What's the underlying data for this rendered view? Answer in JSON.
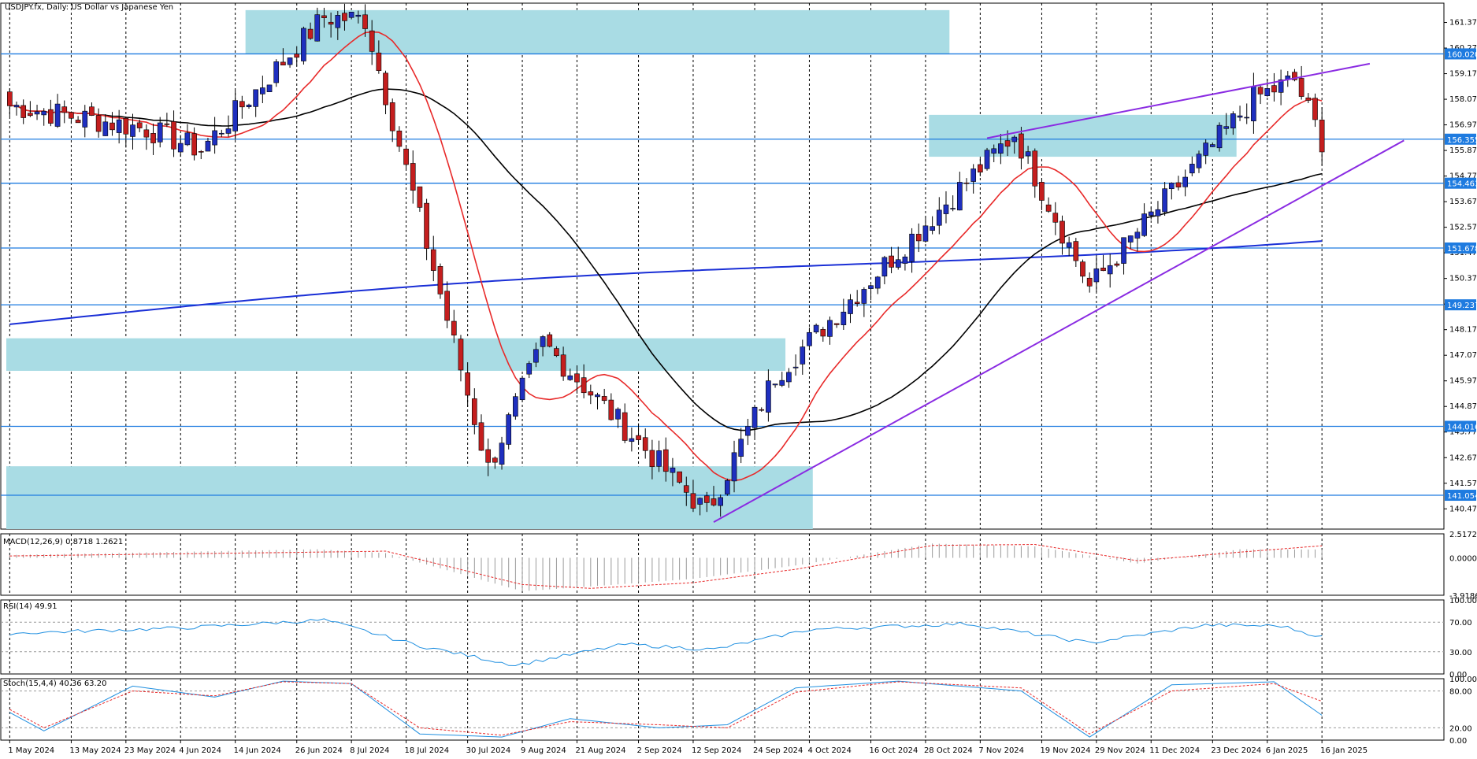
{
  "header": {
    "symbol_title": "USDJPY.fx, Daily:  US Dollar vs Japanese Yen"
  },
  "colors": {
    "bull": "#1f2fbf",
    "bear": "#c41e1e",
    "zone": "#a9dce4",
    "hline": "#1e7be0",
    "ema_fast": "#e82a2a",
    "sma_mid": "#000000",
    "sma_slow": "#1a2fd6",
    "trend": "#8a2be2",
    "osc": "#1f8fe0",
    "signal": "#e82a2a",
    "label_bg": "#1e7be0",
    "grid": "#000000"
  },
  "chart_data": [
    {
      "type": "candlestick",
      "name": "price",
      "title": "USDJPY.fx, Daily:  US Dollar vs Japanese Yen",
      "ylim": [
        139.6,
        162.2
      ],
      "grid": true,
      "y_ticks": [
        "161.370",
        "160.270",
        "159.170",
        "158.070",
        "156.970",
        "155.870",
        "154.770",
        "153.670",
        "152.570",
        "151.470",
        "150.370",
        "149.270",
        "148.170",
        "147.070",
        "145.970",
        "144.870",
        "143.770",
        "142.670",
        "141.570",
        "140.470"
      ],
      "level_labels": [
        {
          "value": 160.02,
          "label": "160.020"
        },
        {
          "value": 156.355,
          "label": "156.355"
        },
        {
          "value": 154.463,
          "label": "154.463"
        },
        {
          "value": 151.678,
          "label": "151.678"
        },
        {
          "value": 149.237,
          "label": "149.237"
        },
        {
          "value": 144.016,
          "label": "144.016"
        },
        {
          "value": 141.054,
          "label": "141.054"
        }
      ],
      "current_price_label": "156.355",
      "x_labels": [
        {
          "index": 0,
          "label": "1 May 2024"
        },
        {
          "index": 9,
          "label": "13 May 2024"
        },
        {
          "index": 17,
          "label": "23 May 2024"
        },
        {
          "index": 25,
          "label": "4 Jun 2024"
        },
        {
          "index": 33,
          "label": "14 Jun 2024"
        },
        {
          "index": 42,
          "label": "26 Jun 2024"
        },
        {
          "index": 50,
          "label": "8 Jul 2024"
        },
        {
          "index": 58,
          "label": "18 Jul 2024"
        },
        {
          "index": 67,
          "label": "30 Jul 2024"
        },
        {
          "index": 75,
          "label": "9 Aug 2024"
        },
        {
          "index": 83,
          "label": "21 Aug 2024"
        },
        {
          "index": 92,
          "label": "2 Sep 2024"
        },
        {
          "index": 100,
          "label": "12 Sep 2024"
        },
        {
          "index": 109,
          "label": "24 Sep 2024"
        },
        {
          "index": 117,
          "label": "4 Oct 2024"
        },
        {
          "index": 126,
          "label": "16 Oct 2024"
        },
        {
          "index": 134,
          "label": "28 Oct 2024"
        },
        {
          "index": 142,
          "label": "7 Nov 2024"
        },
        {
          "index": 151,
          "label": "19 Nov 2024"
        },
        {
          "index": 159,
          "label": "29 Nov 2024"
        },
        {
          "index": 167,
          "label": "11 Dec 2024"
        },
        {
          "index": 176,
          "label": "23 Dec 2024"
        },
        {
          "index": 184,
          "label": "6 Jan 2025"
        },
        {
          "index": 192,
          "label": "16 Jan 2025"
        }
      ],
      "zones": [
        {
          "i0": 35,
          "i1": 138,
          "top": 161.9,
          "bottom": 160.0
        },
        {
          "i0": 0,
          "i1": 114,
          "top": 147.8,
          "bottom": 146.4
        },
        {
          "i0": 0,
          "i1": 118,
          "top": 142.3,
          "bottom": 139.6
        },
        {
          "i0": 135,
          "i1": 180,
          "top": 157.4,
          "bottom": 155.6
        }
      ],
      "trend_lines": [
        {
          "i0": 103,
          "v0": 139.9,
          "i1": 204,
          "v1": 156.3
        },
        {
          "i0": 143,
          "v0": 156.4,
          "i1": 199,
          "v1": 159.6
        }
      ],
      "key_points": [
        {
          "index": 0,
          "price": 157.8
        },
        {
          "index": 20,
          "price": 156.8
        },
        {
          "index": 28,
          "price": 155.9
        },
        {
          "index": 46,
          "price": 161.6
        },
        {
          "index": 52,
          "price": 161.5
        },
        {
          "index": 70,
          "price": 142.2
        },
        {
          "index": 78,
          "price": 147.6
        },
        {
          "index": 102,
          "price": 140.3
        },
        {
          "index": 112,
          "price": 146.2
        },
        {
          "index": 147,
          "price": 156.6
        },
        {
          "index": 158,
          "price": 150.0
        },
        {
          "index": 182,
          "price": 158.1
        },
        {
          "index": 188,
          "price": 158.9
        },
        {
          "index": 192,
          "price": 156.3
        }
      ]
    },
    {
      "type": "line",
      "name": "macd",
      "title": "MACD(12,26,9) 0.8718 1.2621",
      "ylim": [
        -3.9186,
        2.5172
      ],
      "y_ticks": [
        "2.5172",
        "0.0000",
        "-3.9186"
      ],
      "key_points": [
        {
          "index": 0,
          "main": 0.3,
          "signal": 0.2
        },
        {
          "index": 45,
          "main": 0.9,
          "signal": 0.6
        },
        {
          "index": 55,
          "main": 0.5,
          "signal": 0.7
        },
        {
          "index": 75,
          "main": -3.5,
          "signal": -2.8
        },
        {
          "index": 85,
          "main": -3.0,
          "signal": -3.2
        },
        {
          "index": 100,
          "main": -2.2,
          "signal": -2.6
        },
        {
          "index": 115,
          "main": -0.8,
          "signal": -1.2
        },
        {
          "index": 135,
          "main": 1.5,
          "signal": 1.3
        },
        {
          "index": 150,
          "main": 1.2,
          "signal": 1.4
        },
        {
          "index": 165,
          "main": -0.6,
          "signal": -0.3
        },
        {
          "index": 180,
          "main": 0.9,
          "signal": 0.6
        },
        {
          "index": 192,
          "main": 0.8718,
          "signal": 1.2621
        }
      ]
    },
    {
      "type": "line",
      "name": "rsi",
      "title": "RSI(14) 49.91",
      "ylim": [
        0,
        100
      ],
      "y_ticks": [
        "100.00",
        "70.00",
        "30.00",
        "0.00"
      ],
      "key_points": [
        {
          "index": 0,
          "value": 55
        },
        {
          "index": 25,
          "value": 62
        },
        {
          "index": 46,
          "value": 73
        },
        {
          "index": 60,
          "value": 38
        },
        {
          "index": 74,
          "value": 12
        },
        {
          "index": 90,
          "value": 40
        },
        {
          "index": 103,
          "value": 33
        },
        {
          "index": 117,
          "value": 60
        },
        {
          "index": 140,
          "value": 68
        },
        {
          "index": 158,
          "value": 42
        },
        {
          "index": 175,
          "value": 66
        },
        {
          "index": 186,
          "value": 65
        },
        {
          "index": 192,
          "value": 49.91
        }
      ]
    },
    {
      "type": "line",
      "name": "stochastic",
      "title": "Stoch(15,4,4) 40.36 63.20",
      "ylim": [
        0,
        100
      ],
      "y_ticks": [
        "100.00",
        "80.00",
        "20.00",
        "0.00"
      ],
      "key_points": [
        {
          "index": 0,
          "k": 45,
          "d": 50
        },
        {
          "index": 5,
          "k": 15,
          "d": 20
        },
        {
          "index": 18,
          "k": 88,
          "d": 80
        },
        {
          "index": 30,
          "k": 70,
          "d": 72
        },
        {
          "index": 40,
          "k": 96,
          "d": 95
        },
        {
          "index": 50,
          "k": 92,
          "d": 92
        },
        {
          "index": 60,
          "k": 10,
          "d": 20
        },
        {
          "index": 72,
          "k": 5,
          "d": 8
        },
        {
          "index": 82,
          "k": 35,
          "d": 30
        },
        {
          "index": 95,
          "k": 20,
          "d": 25
        },
        {
          "index": 105,
          "k": 25,
          "d": 20
        },
        {
          "index": 115,
          "k": 85,
          "d": 78
        },
        {
          "index": 130,
          "k": 96,
          "d": 95
        },
        {
          "index": 148,
          "k": 80,
          "d": 85
        },
        {
          "index": 158,
          "k": 5,
          "d": 10
        },
        {
          "index": 170,
          "k": 90,
          "d": 80
        },
        {
          "index": 185,
          "k": 95,
          "d": 92
        },
        {
          "index": 192,
          "k": 40.36,
          "d": 63.2
        }
      ]
    }
  ]
}
